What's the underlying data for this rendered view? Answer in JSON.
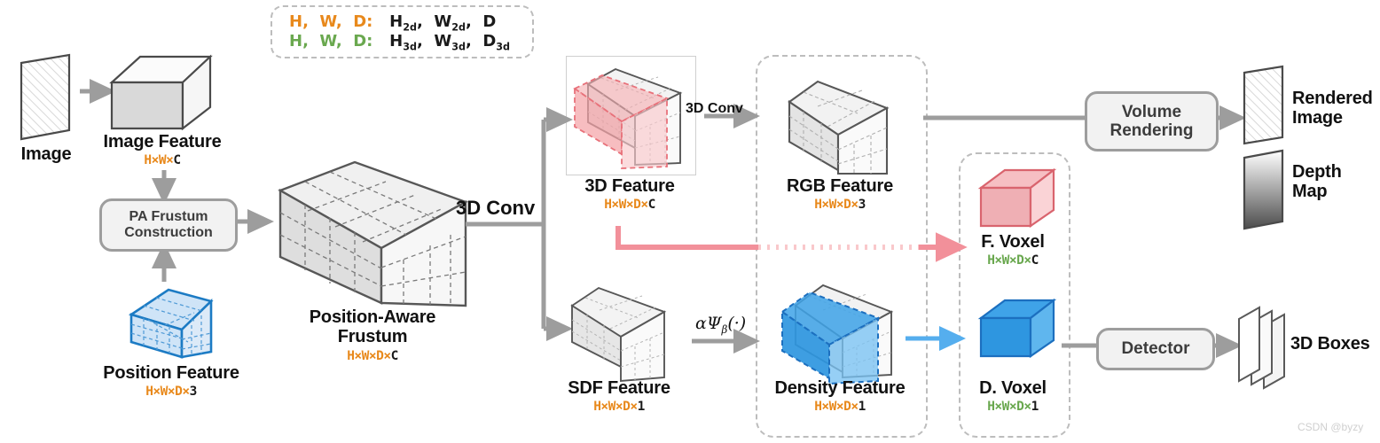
{
  "legend": {
    "row1": {
      "keys": [
        "H,",
        "W,",
        "D:"
      ],
      "values": "H2d,  W2d,  D",
      "color": "#E8891C"
    },
    "row2": {
      "keys": [
        "H,",
        "W,",
        "D:"
      ],
      "values": "H3d,  W3d,  D3d",
      "color": "#6AA84F"
    }
  },
  "nodes": {
    "image": {
      "label": "Image",
      "dim": ""
    },
    "image_feature": {
      "label": "Image Feature",
      "dim_hwd": "H×W×",
      "dim_tail": "C"
    },
    "pa_frustum": {
      "label_line1": "PA Frustum",
      "label_line2": "Construction"
    },
    "position_feature": {
      "label": "Position Feature",
      "dim_hwd": "H×W×D×",
      "dim_tail": "3"
    },
    "pa_frustum_out": {
      "label_line1": "Position-Aware",
      "label_line2": "Frustum",
      "dim_hwd": "H×W×D×",
      "dim_tail": "C"
    },
    "feature_3d": {
      "label": "3D Feature",
      "dim_hwd": "H×W×D×",
      "dim_tail": "C"
    },
    "sdf_feature": {
      "label": "SDF Feature",
      "dim_hwd": "H×W×D×",
      "dim_tail": "1"
    },
    "rgb_feature": {
      "label": "RGB Feature",
      "dim_hwd": "H×W×D×",
      "dim_tail": "3"
    },
    "density_feature": {
      "label": "Density Feature",
      "dim_hwd": "H×W×D×",
      "dim_tail": "1"
    },
    "f_voxel": {
      "label": "F. Voxel",
      "dim_hwd": "H×W×D×",
      "dim_tail": "C"
    },
    "d_voxel": {
      "label": "D. Voxel",
      "dim_hwd": "H×W×D×",
      "dim_tail": "1"
    },
    "rendered_image": {
      "label_line1": "Rendered",
      "label_line2": "Image"
    },
    "depth_map": {
      "label_line1": "Depth",
      "label_line2": "Map"
    },
    "boxes_3d": {
      "label": "3D Boxes"
    }
  },
  "ops": {
    "conv_main": "3D Conv",
    "conv_branch": "3D Conv",
    "sdf_transform": "αΨ",
    "sdf_transform_sub": "β",
    "sdf_transform_tail": "(·)",
    "volume_rendering_line1": "Volume",
    "volume_rendering_line2": "Rendering",
    "detector": "Detector"
  },
  "watermark": "CSDN @byzy",
  "colors": {
    "orange": "#E8891C",
    "green": "#6AA84F",
    "pink_fill": "#F8C9CC",
    "pink_stroke": "#E8717A",
    "blue_fill": "#4FA8E8",
    "blue_stroke": "#1C6FBF",
    "grey_line": "#9d9d9d",
    "dashed_border": "#bdbdbd"
  }
}
